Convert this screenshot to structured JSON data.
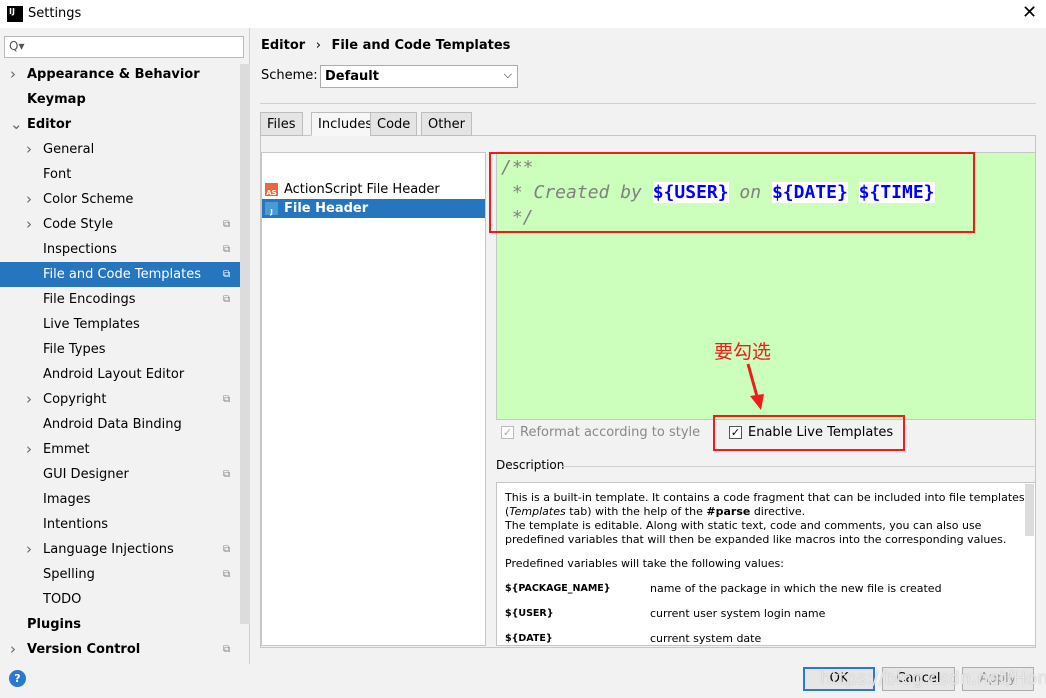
{
  "window": {
    "title": "Settings",
    "logo": "IJ"
  },
  "search": {
    "placeholder": "Q▾"
  },
  "tree": [
    {
      "label": "Appearance & Behavior",
      "level": 0,
      "arrow": true,
      "bold": true
    },
    {
      "label": "Keymap",
      "level": 0,
      "bold": true
    },
    {
      "label": "Editor",
      "level": 0,
      "arrow": true,
      "expanded": true,
      "bold": true
    },
    {
      "label": "General",
      "level": 1,
      "arrow": true
    },
    {
      "label": "Font",
      "level": 1
    },
    {
      "label": "Color Scheme",
      "level": 1,
      "arrow": true
    },
    {
      "label": "Code Style",
      "level": 1,
      "arrow": true,
      "copy": true
    },
    {
      "label": "Inspections",
      "level": 1,
      "copy": true
    },
    {
      "label": "File and Code Templates",
      "level": 1,
      "copy": true,
      "selected": true
    },
    {
      "label": "File Encodings",
      "level": 1,
      "copy": true
    },
    {
      "label": "Live Templates",
      "level": 1
    },
    {
      "label": "File Types",
      "level": 1
    },
    {
      "label": "Android Layout Editor",
      "level": 1
    },
    {
      "label": "Copyright",
      "level": 1,
      "arrow": true,
      "copy": true
    },
    {
      "label": "Android Data Binding",
      "level": 1
    },
    {
      "label": "Emmet",
      "level": 1,
      "arrow": true
    },
    {
      "label": "GUI Designer",
      "level": 1,
      "copy": true
    },
    {
      "label": "Images",
      "level": 1
    },
    {
      "label": "Intentions",
      "level": 1
    },
    {
      "label": "Language Injections",
      "level": 1,
      "arrow": true,
      "copy": true
    },
    {
      "label": "Spelling",
      "level": 1,
      "copy": true
    },
    {
      "label": "TODO",
      "level": 1
    },
    {
      "label": "Plugins",
      "level": 0,
      "bold": true
    },
    {
      "label": "Version Control",
      "level": 0,
      "arrow": true,
      "copy": true,
      "bold": true
    }
  ],
  "breadcrumb": {
    "parent": "Editor",
    "sep": "›",
    "current": "File and Code Templates"
  },
  "scheme": {
    "label": "Scheme:",
    "value": "Default"
  },
  "tabs": [
    {
      "label": "Files"
    },
    {
      "label": "Includes",
      "active": true
    },
    {
      "label": "Code"
    },
    {
      "label": "Other"
    }
  ],
  "templates": [
    {
      "label": "ActionScript File Header",
      "icon": "AS"
    },
    {
      "label": "File Header",
      "icon": "J",
      "selected": true
    }
  ],
  "editor": {
    "line1": "/**",
    "line2_pre": " * Created by ",
    "v_user": "${USER}",
    "on": " on ",
    "v_date": "${DATE}",
    "v_time": "${TIME}",
    "line3": " */"
  },
  "annotation": "要勾选",
  "options": {
    "reformat": "Reformat according to style",
    "live": "Enable Live Templates"
  },
  "description": {
    "title": "Description",
    "p1a": "This is a built-in template. It contains a code fragment that can be included into file templates (",
    "p1i": "Templates",
    "p1b": " tab) with the help of the ",
    "p1c": "#parse",
    "p1d": " directive.",
    "p2": "The template is editable. Along with static text, code and comments, you can also use predefined variables that will then be expanded like macros into the corresponding values.",
    "p3": "Predefined variables will take the following values:",
    "vars": [
      {
        "name": "${PACKAGE_NAME}",
        "desc": "name of the package in which the new file is created"
      },
      {
        "name": "${USER}",
        "desc": "current user system login name"
      },
      {
        "name": "${DATE}",
        "desc": "current system date"
      }
    ]
  },
  "buttons": {
    "ok": "OK",
    "cancel": "Cancel",
    "apply": "Apply",
    "help": "?"
  },
  "watermark": "https://blog.csdn.net/HongRi_",
  "colors": {
    "selection": "#2675bf",
    "editor_bg": "#ccffbb",
    "highlight": "#f01c1c"
  }
}
